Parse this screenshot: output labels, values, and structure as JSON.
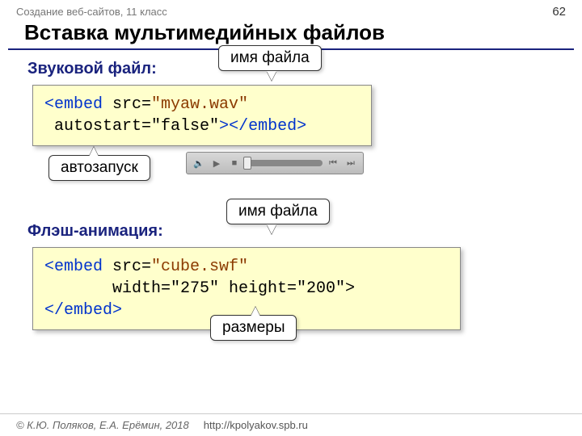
{
  "header": {
    "left": "Создание веб-сайтов, 11 класс",
    "pagenum": "62"
  },
  "title": "Вставка мультимедийных файлов",
  "audio": {
    "label": "Звуковой файл:",
    "code": {
      "open_tag": "<embed",
      "attr_src_name": " src=",
      "attr_src_val": "\"myaw.wav\"",
      "line2a": " autostart=",
      "line2b": "\"false\"",
      "close1": ">",
      "close_tag": "</embed>"
    },
    "callout_filename": "имя файла",
    "callout_autostart": "автозапуск"
  },
  "flash": {
    "label": "Флэш-анимация:",
    "code": {
      "open_tag": "<embed",
      "attr_src_name": " src=",
      "attr_src_val": "\"cube.swf\"",
      "line2": "       width=\"275\" height=\"200\">",
      "close_tag": "</embed>"
    },
    "callout_filename": "имя файла",
    "callout_size": "размеры"
  },
  "footer": {
    "copyright": "© К.Ю. Поляков, Е.А. Ерёмин, 2018",
    "url": "http://kpolyakov.spb.ru"
  }
}
